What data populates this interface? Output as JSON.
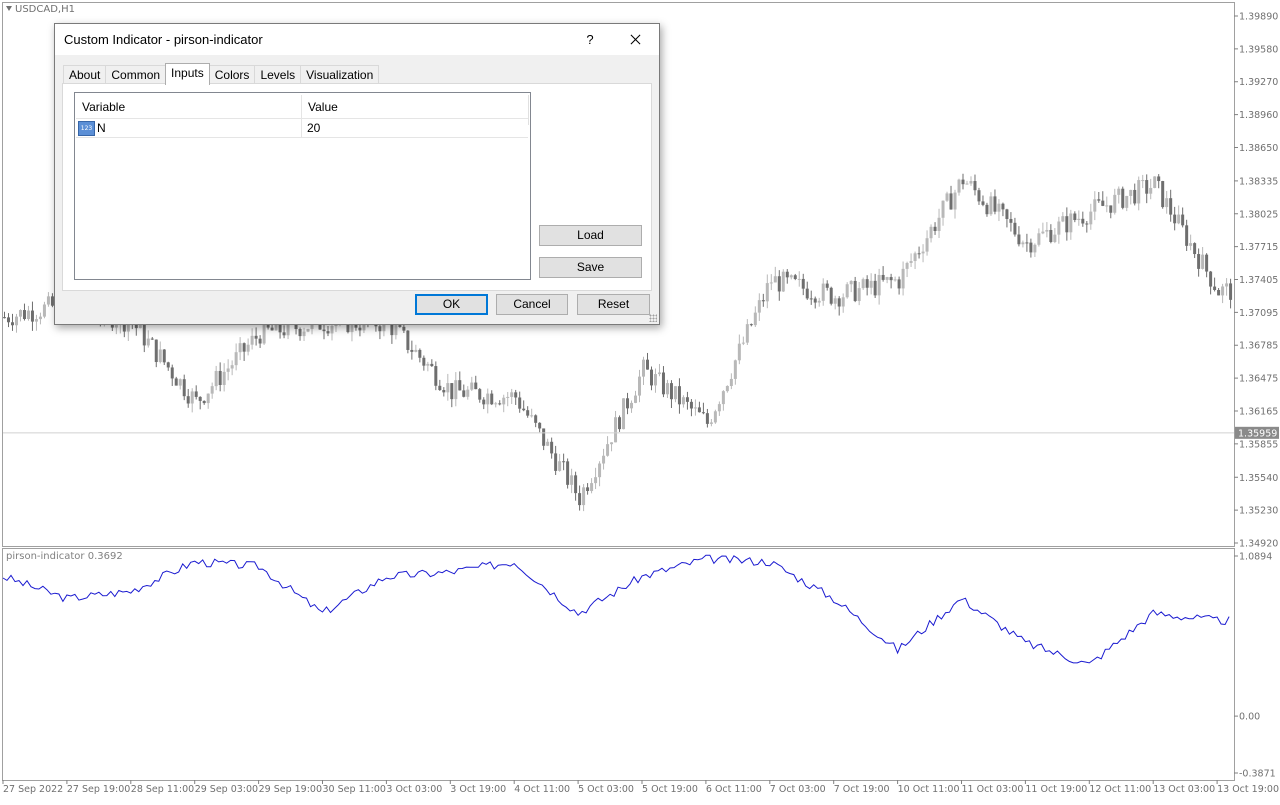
{
  "chart": {
    "symbol_label": "USDCAD,H1",
    "subwindow_label": "pirson-indicator 0.3692",
    "current_price": "1.35959",
    "price_ticks": [
      "1.39890",
      "1.39580",
      "1.39270",
      "1.38960",
      "1.38650",
      "1.38335",
      "1.38025",
      "1.37715",
      "1.37405",
      "1.37095",
      "1.36785",
      "1.36475",
      "1.36165",
      "1.35855",
      "1.35540",
      "1.35230",
      "1.34920"
    ],
    "indicator_ticks": [
      "1.0894",
      "0.00",
      "-0.3871"
    ],
    "time_ticks": [
      "27 Sep 2022",
      "27 Sep 19:00",
      "28 Sep 11:00",
      "29 Sep 03:00",
      "29 Sep 19:00",
      "30 Sep 11:00",
      "3 Oct 03:00",
      "3 Oct 19:00",
      "4 Oct 11:00",
      "5 Oct 03:00",
      "5 Oct 19:00",
      "6 Oct 11:00",
      "7 Oct 03:00",
      "7 Oct 19:00",
      "10 Oct 11:00",
      "11 Oct 03:00",
      "11 Oct 19:00",
      "12 Oct 11:00",
      "13 Oct 03:00",
      "13 Oct 19:00"
    ],
    "colors": {
      "bull": "#b8b8b8",
      "bear": "#6e6e6e",
      "indicator_line": "#1a1ad0",
      "grid": "#b0b0b0"
    }
  },
  "chart_data": [
    {
      "type": "candlestick",
      "title": "USDCAD,H1",
      "xlabel": "",
      "ylabel": "",
      "ylim": [
        1.3492,
        1.3989
      ],
      "x": [
        "27 Sep 2022",
        "27 Sep 19:00",
        "28 Sep 11:00",
        "29 Sep 03:00",
        "29 Sep 19:00",
        "30 Sep 11:00",
        "3 Oct 03:00",
        "3 Oct 19:00",
        "4 Oct 11:00",
        "5 Oct 03:00",
        "5 Oct 19:00",
        "6 Oct 11:00",
        "7 Oct 03:00",
        "7 Oct 19:00",
        "10 Oct 11:00",
        "11 Oct 03:00",
        "11 Oct 19:00",
        "12 Oct 11:00",
        "13 Oct 03:00",
        "13 Oct 19:00"
      ],
      "close": [
        1.3705,
        1.3718,
        1.37,
        1.3625,
        1.369,
        1.37,
        1.37,
        1.3635,
        1.363,
        1.3535,
        1.3655,
        1.3605,
        1.374,
        1.3725,
        1.374,
        1.3835,
        1.3775,
        1.3805,
        1.383,
        1.373
      ],
      "last_price": 1.35959
    },
    {
      "type": "line",
      "title": "pirson-indicator 0.3692",
      "xlabel": "",
      "ylabel": "",
      "ylim": [
        -0.3871,
        1.0894
      ],
      "x": [
        "27 Sep 2022",
        "27 Sep 19:00",
        "28 Sep 11:00",
        "29 Sep 03:00",
        "29 Sep 19:00",
        "30 Sep 11:00",
        "3 Oct 03:00",
        "3 Oct 19:00",
        "4 Oct 11:00",
        "5 Oct 03:00",
        "5 Oct 19:00",
        "6 Oct 11:00",
        "7 Oct 03:00",
        "7 Oct 19:00",
        "10 Oct 11:00",
        "11 Oct 03:00",
        "11 Oct 19:00",
        "12 Oct 11:00",
        "13 Oct 03:00",
        "13 Oct 19:00"
      ],
      "series": [
        {
          "values": [
            0.95,
            0.8,
            0.85,
            1.05,
            1.02,
            0.7,
            0.95,
            0.98,
            1.05,
            0.7,
            0.95,
            1.07,
            1.05,
            0.8,
            0.45,
            0.8,
            0.5,
            0.35,
            0.7,
            0.65
          ]
        }
      ]
    }
  ],
  "dialog": {
    "title": "Custom Indicator - pirson-indicator",
    "help": "?",
    "tabs": [
      "About",
      "Common",
      "Inputs",
      "Colors",
      "Levels",
      "Visualization"
    ],
    "active_tab": "Inputs",
    "grid": {
      "col_variable": "Variable",
      "col_value": "Value",
      "rows": [
        {
          "icon": "123",
          "variable": "N",
          "value": "20"
        }
      ]
    },
    "load": "Load",
    "save": "Save",
    "ok": "OK",
    "cancel": "Cancel",
    "reset": "Reset"
  }
}
